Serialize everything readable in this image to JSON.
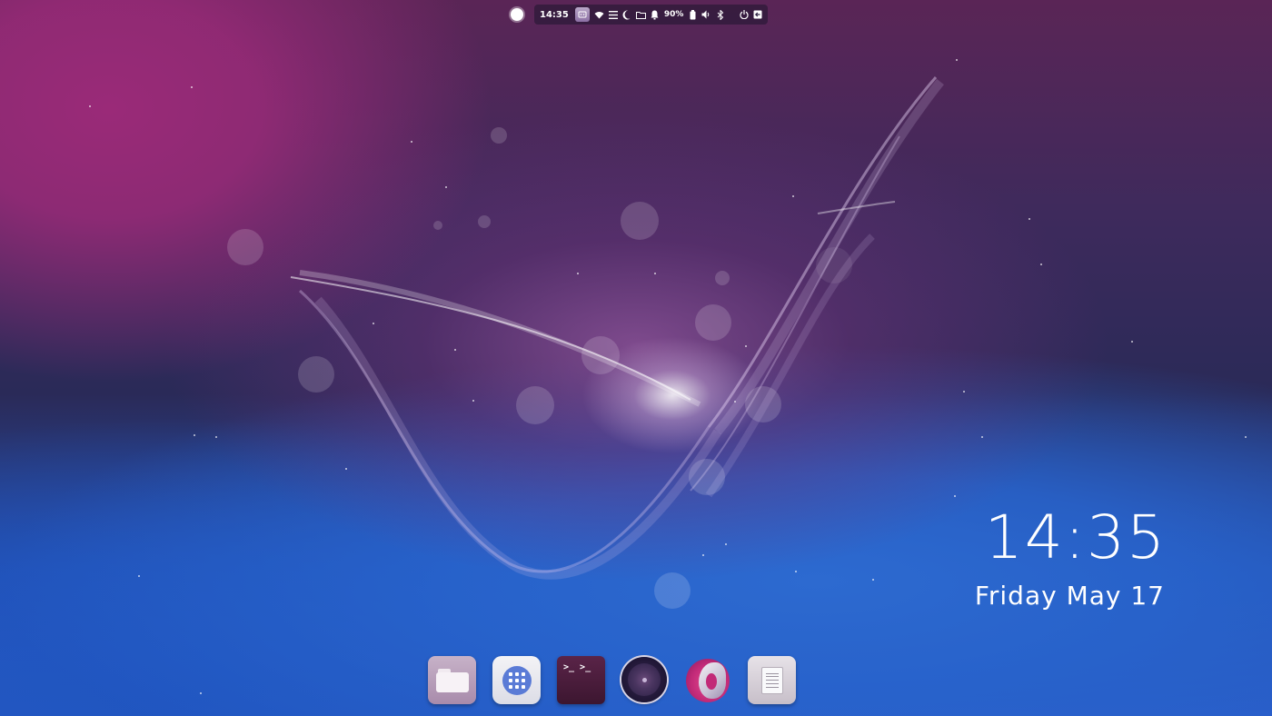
{
  "topbar": {
    "activities_icon": "activities-icon",
    "time": "14:35",
    "app_indicator_icon": "indicator-app-icon",
    "wifi_icon": "wifi-icon",
    "menu_icon": "hamburger-menu-icon",
    "night_light_icon": "moon-icon",
    "folder_icon": "folder-icon",
    "notification_icon": "bell-icon",
    "battery_percent": "90%",
    "battery_icon": "battery-icon",
    "volume_icon": "speaker-icon",
    "bluetooth_icon": "bluetooth-icon",
    "power_icon": "power-icon",
    "logout_icon": "logout-icon"
  },
  "clock_widget": {
    "time": "14:35",
    "date": "Friday May 17"
  },
  "dock": {
    "items": [
      {
        "name": "Files",
        "icon": "folder-icon"
      },
      {
        "name": "Show Applications",
        "icon": "app-grid-icon"
      },
      {
        "name": "Terminal",
        "icon": "terminal-icon",
        "prompt": ">_ >_"
      },
      {
        "name": "Music",
        "icon": "music-disc-icon"
      },
      {
        "name": "Firefox",
        "icon": "firefox-icon"
      },
      {
        "name": "Text Editor",
        "icon": "text-document-icon"
      }
    ]
  },
  "colors": {
    "wallpaper_magenta": "#9a2a78",
    "wallpaper_navy": "#2a2a58",
    "wallpaper_blue": "#2d6ad0",
    "text": "#ffffff"
  }
}
